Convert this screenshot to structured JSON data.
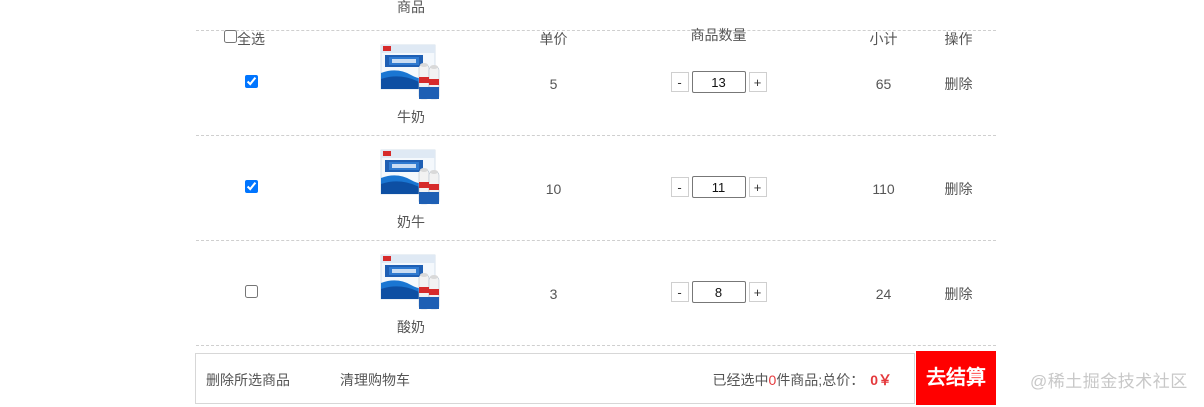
{
  "header": {
    "select_all": "全选",
    "product": "商品",
    "price": "单价",
    "quantity": "商品数量",
    "subtotal": "小计",
    "action": "操作"
  },
  "items": [
    {
      "checked": true,
      "name": "牛奶",
      "price": "5",
      "qty": "13",
      "subtotal": "65",
      "action": "删除",
      "minus": "-",
      "plus": "+"
    },
    {
      "checked": true,
      "name": "奶牛",
      "price": "10",
      "qty": "11",
      "subtotal": "110",
      "action": "删除",
      "minus": "-",
      "plus": "+"
    },
    {
      "checked": false,
      "name": "酸奶",
      "price": "3",
      "qty": "8",
      "subtotal": "24",
      "action": "删除",
      "minus": "-",
      "plus": "+"
    }
  ],
  "footer": {
    "delete_selected": "删除所选商品",
    "clear_cart": "清理购物车",
    "selected_prefix": "已经选中",
    "selected_count": "0",
    "selected_suffix": "件商品;总价：",
    "total": "0￥",
    "checkout": "去结算"
  },
  "watermark": "@稀土掘金技术社区",
  "colors": {
    "accent_red": "#ff0000",
    "price_red": "#e4393c"
  }
}
